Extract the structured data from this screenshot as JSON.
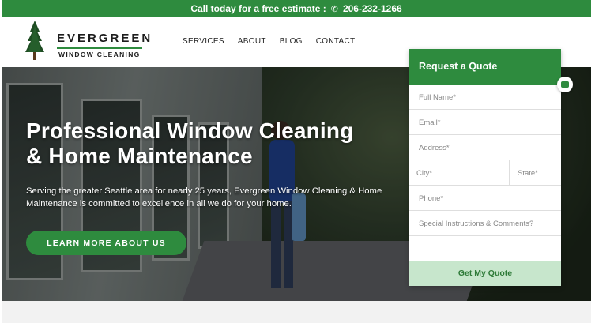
{
  "topbar": {
    "text": "Call today for a free estimate :",
    "phone": "206-232-1266",
    "icon": "phone-icon"
  },
  "logo": {
    "name": "EVERGREEN",
    "subtitle": "WINDOW CLEANING",
    "icon": "pine-tree-icon"
  },
  "nav": {
    "items": [
      {
        "label": "SERVICES"
      },
      {
        "label": "ABOUT"
      },
      {
        "label": "BLOG"
      },
      {
        "label": "CONTACT"
      }
    ]
  },
  "hero": {
    "title_line1": "Professional Window Cleaning",
    "title_line2": "& Home Maintenance",
    "description": "Serving the greater Seattle area for nearly 25 years, Evergreen Window Cleaning & Home Maintenance is committed to excellence in all we do for your home.",
    "button": "LEARN MORE ABOUT US"
  },
  "quote": {
    "title": "Request a Quote",
    "full_name": "Full Name*",
    "email": "Email*",
    "address": "Address*",
    "city": "City*",
    "state": "State*",
    "phone": "Phone*",
    "comments": "Special Instructions & Comments?",
    "submit": "Get My Quote"
  },
  "colors": {
    "brand_green": "#2e8b3e",
    "button_light": "#c7e6cc"
  }
}
